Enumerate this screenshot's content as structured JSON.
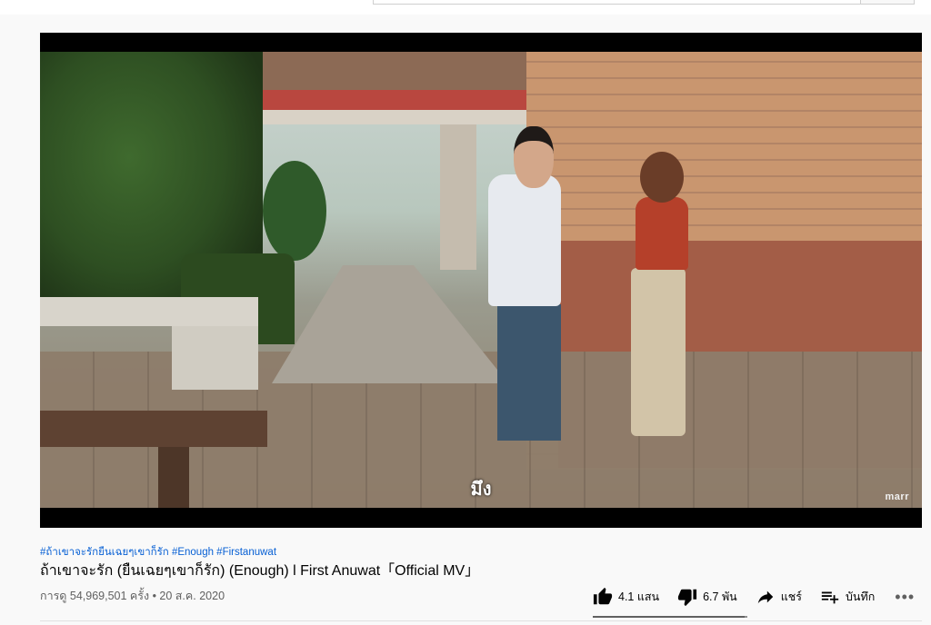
{
  "video": {
    "subtitle": "มึง",
    "watermark": "marr"
  },
  "info": {
    "hashtags": "#ถ้าเขาจะรักยืนเฉยๆเขาก็รัก #Enough #Firstanuwat",
    "title": "ถ้าเขาจะรัก (ยืนเฉยๆเขาก็รัก) (Enough) l First Anuwat「Official MV」",
    "views": "การดู 54,969,501 ครั้ง • 20 ส.ค. 2020"
  },
  "actions": {
    "like_label": "4.1 แสน",
    "dislike_label": "6.7 พัน",
    "share_label": "แชร์",
    "save_label": "บันทึก",
    "more_label": "•••",
    "like_ratio": 0.98
  },
  "icons": {
    "like": "thumb-up-icon",
    "dislike": "thumb-down-icon",
    "share": "share-arrow-icon",
    "save": "playlist-add-icon",
    "more": "more-horizontal-icon"
  }
}
